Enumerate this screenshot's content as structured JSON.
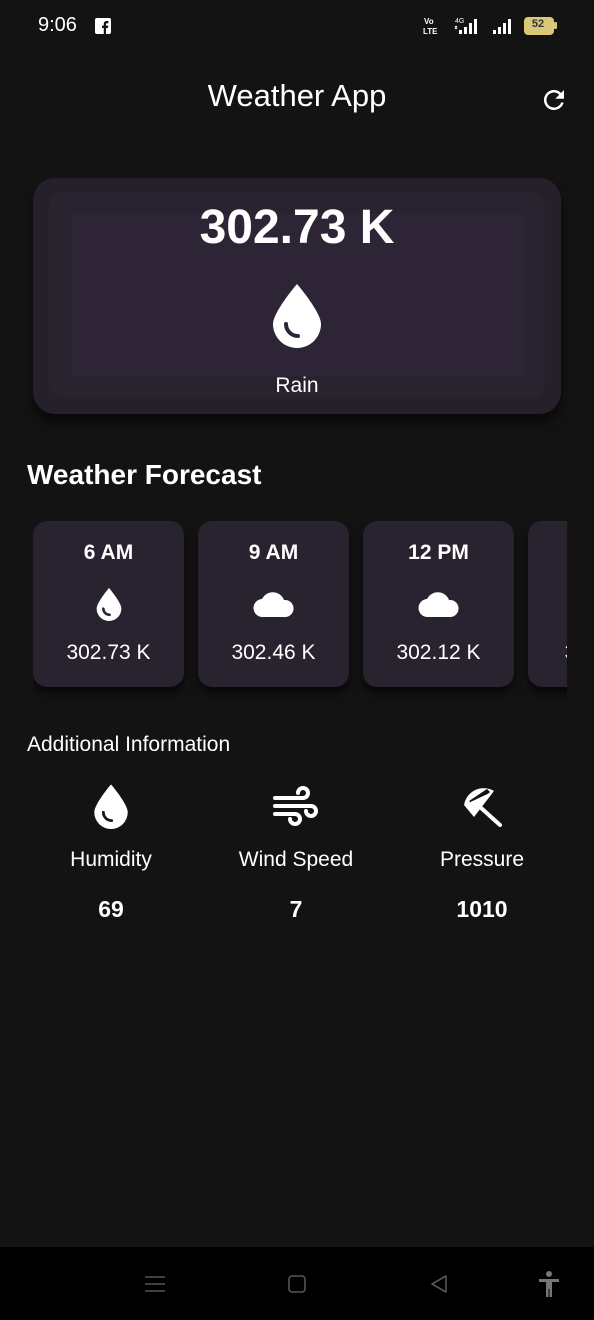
{
  "status_bar": {
    "time": "9:06",
    "battery_level": "52",
    "icons": [
      "facebook-icon",
      "volte-icon",
      "signal-4g-icon",
      "signal-icon",
      "battery-icon"
    ]
  },
  "app_bar": {
    "title": "Weather App",
    "refresh_icon": "refresh-icon"
  },
  "current": {
    "temperature": "302.73 K",
    "condition": "Rain",
    "icon": "water-drop-icon"
  },
  "forecast": {
    "title": "Weather Forecast",
    "items": [
      {
        "time": "6 AM",
        "temperature": "302.73 K",
        "icon": "water-drop-icon"
      },
      {
        "time": "9 AM",
        "temperature": "302.46 K",
        "icon": "cloud-icon"
      },
      {
        "time": "12 PM",
        "temperature": "302.12 K",
        "icon": "cloud-icon"
      },
      {
        "time": "",
        "temperature": "3",
        "icon": ""
      }
    ]
  },
  "additional": {
    "title": "Additional Information",
    "items": [
      {
        "label": "Humidity",
        "value": "69",
        "icon": "water-drop-icon"
      },
      {
        "label": "Wind Speed",
        "value": "7",
        "icon": "air-icon"
      },
      {
        "label": "Pressure",
        "value": "1010",
        "icon": "beach-umbrella-icon"
      }
    ]
  },
  "nav_bar": {
    "icons": [
      "menu-icon",
      "home-icon",
      "back-icon",
      "accessibility-icon"
    ]
  },
  "colors": {
    "background": "#131313",
    "card": "#29222f",
    "text": "#ffffff"
  }
}
